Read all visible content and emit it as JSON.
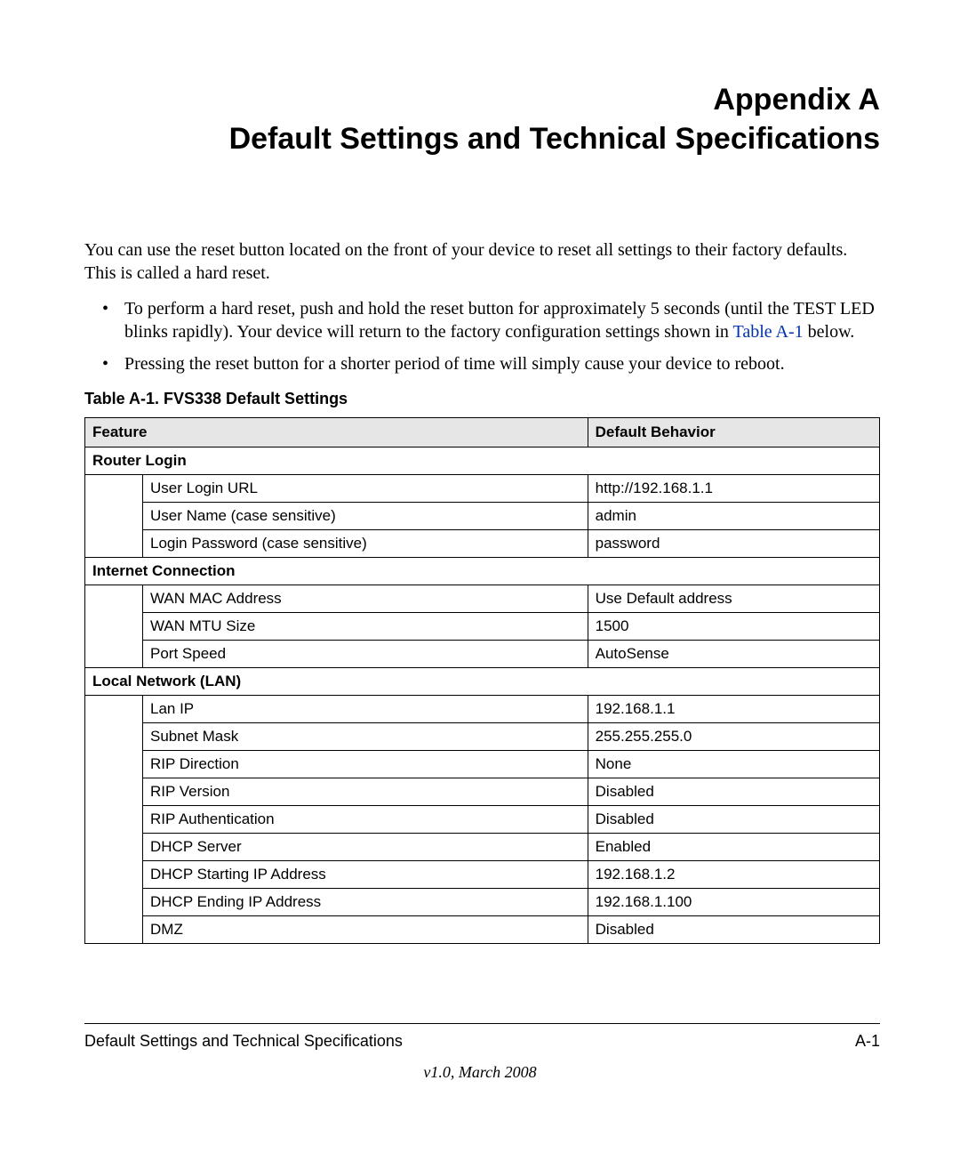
{
  "title": {
    "line1": "Appendix A",
    "line2": "Default Settings and Technical Specifications"
  },
  "intro": "You can use the reset button located on the front of your device to reset all settings to their factory defaults. This is called a hard reset.",
  "bullets": {
    "b1_prefix": "To perform a hard reset, push and hold the reset button for approximately 5 seconds (until the TEST LED blinks rapidly). Your device will return to the factory configuration settings shown in ",
    "b1_link": "Table A-1",
    "b1_suffix": " below.",
    "b2": "Pressing the reset button for a shorter period of time will simply cause your device to reboot."
  },
  "table_caption": "Table A-1.  FVS338 Default Settings",
  "headers": {
    "feature": "Feature",
    "behavior": "Default Behavior"
  },
  "sections": {
    "router_login": "Router Login",
    "internet": "Internet Connection",
    "lan": "Local Network (LAN)"
  },
  "rows": {
    "rl_url_f": "User Login URL",
    "rl_url_v": "http://192.168.1.1",
    "rl_user_f": "User Name (case sensitive)",
    "rl_user_v": "admin",
    "rl_pass_f": "Login Password (case sensitive)",
    "rl_pass_v": "password",
    "ic_mac_f": "WAN MAC Address",
    "ic_mac_v": "Use Default address",
    "ic_mtu_f": "WAN MTU Size",
    "ic_mtu_v": "1500",
    "ic_port_f": "Port Speed",
    "ic_port_v": "AutoSense",
    "lan_ip_f": "Lan IP",
    "lan_ip_v": "192.168.1.1",
    "lan_subnet_f": "Subnet Mask",
    "lan_subnet_v": "255.255.255.0",
    "lan_ripd_f": "RIP Direction",
    "lan_ripd_v": "None",
    "lan_ripv_f": "RIP Version",
    "lan_ripv_v": "Disabled",
    "lan_ripa_f": "RIP Authentication",
    "lan_ripa_v": "Disabled",
    "lan_dhcp_f": "DHCP Server",
    "lan_dhcp_v": "Enabled",
    "lan_dhcps_f": "DHCP Starting IP Address",
    "lan_dhcps_v": "192.168.1.2",
    "lan_dhcpe_f": "DHCP Ending IP Address",
    "lan_dhcpe_v": "192.168.1.100",
    "lan_dmz_f": "DMZ",
    "lan_dmz_v": "Disabled"
  },
  "footer": {
    "left": "Default Settings and Technical Specifications",
    "right": "A-1",
    "version": "v1.0, March 2008"
  }
}
